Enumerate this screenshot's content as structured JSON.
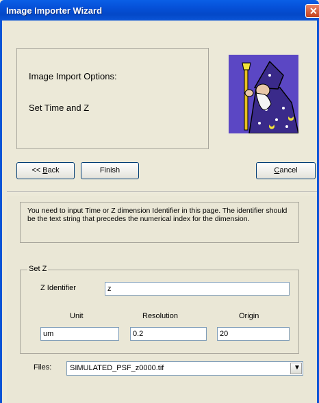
{
  "window": {
    "title": "Image Importer Wizard"
  },
  "header": {
    "line1": "Image Import Options:",
    "line2": "Set Time and Z"
  },
  "nav": {
    "back_prefix": "<< ",
    "back_key": "B",
    "back_rest": "ack",
    "finish": "Finish",
    "cancel_key": "C",
    "cancel_rest": "ancel"
  },
  "info": {
    "text": "You need to input Time or Z dimension Identifier in this page.  The identifier should be the text string that precedes the numerical index for the dimension."
  },
  "setz": {
    "legend": "Set Z",
    "identifier_label": "Z Identifier",
    "identifier_value": "z",
    "unit_label": "Unit",
    "unit_value": "um",
    "resolution_label": "Resolution",
    "resolution_value": "0.2",
    "origin_label": "Origin",
    "origin_value": "20"
  },
  "files": {
    "label": "Files:",
    "selected": "SIMULATED_PSF_z0000.tif"
  },
  "icons": {
    "close": "close-icon",
    "wizard": "wizard-image",
    "dropdown": "chevron-down-icon"
  }
}
